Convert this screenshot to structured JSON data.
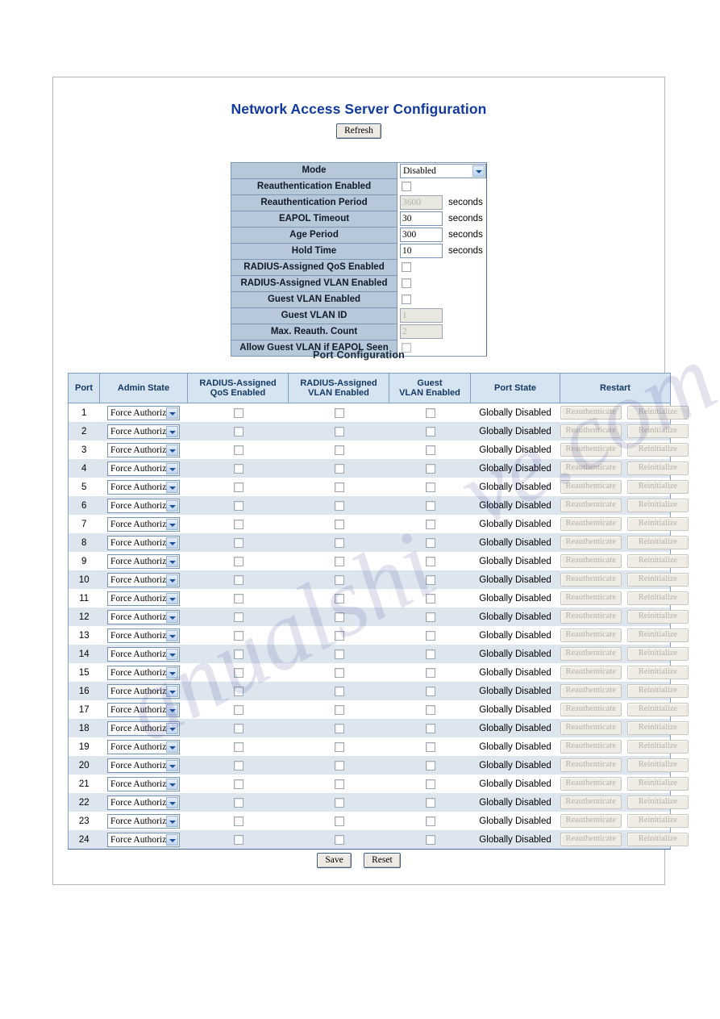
{
  "page": {
    "title": "Network Access Server Configuration",
    "refresh_label": "Refresh",
    "section_heading": "Port Configuration",
    "save_label": "Save",
    "reset_label": "Reset",
    "watermark_1": "ve.com",
    "watermark_2": "anualshi"
  },
  "global_config": {
    "rows": [
      {
        "label": "Mode",
        "control": "select",
        "value": "Disabled",
        "unit": "",
        "disabled": false
      },
      {
        "label": "Reauthentication Enabled",
        "control": "checkbox",
        "value": "",
        "unit": "",
        "disabled": false,
        "checked": false
      },
      {
        "label": "Reauthentication Period",
        "control": "text",
        "value": "3600",
        "unit": "seconds",
        "disabled": true
      },
      {
        "label": "EAPOL Timeout",
        "control": "text",
        "value": "30",
        "unit": "seconds",
        "disabled": false
      },
      {
        "label": "Age Period",
        "control": "text",
        "value": "300",
        "unit": "seconds",
        "disabled": false
      },
      {
        "label": "Hold Time",
        "control": "text",
        "value": "10",
        "unit": "seconds",
        "disabled": false
      },
      {
        "label": "RADIUS-Assigned QoS Enabled",
        "control": "checkbox",
        "value": "",
        "unit": "",
        "disabled": false,
        "checked": false
      },
      {
        "label": "RADIUS-Assigned VLAN Enabled",
        "control": "checkbox",
        "value": "",
        "unit": "",
        "disabled": false,
        "checked": false
      },
      {
        "label": "Guest VLAN Enabled",
        "control": "checkbox",
        "value": "",
        "unit": "",
        "disabled": false,
        "checked": false
      },
      {
        "label": "Guest VLAN ID",
        "control": "text",
        "value": "1",
        "unit": "",
        "disabled": true
      },
      {
        "label": "Max. Reauth. Count",
        "control": "text",
        "value": "2",
        "unit": "",
        "disabled": true
      },
      {
        "label": "Allow Guest VLAN if EAPOL Seen",
        "control": "checkbox",
        "value": "",
        "unit": "",
        "disabled": true,
        "checked": false
      }
    ]
  },
  "port_table": {
    "headers": [
      "Port",
      "Admin State",
      "RADIUS-Assigned\nQoS Enabled",
      "RADIUS-Assigned\nVLAN Enabled",
      "Guest\nVLAN Enabled",
      "Port State",
      "Restart"
    ],
    "restart_buttons": {
      "reauthenticate": "Reauthenticate",
      "reinitialize": "Reinitialize"
    },
    "rows": [
      {
        "port": "1",
        "admin_state": "Force Authorized",
        "radius_qos": false,
        "radius_vlan": false,
        "guest_vlan": false,
        "port_state": "Globally Disabled"
      },
      {
        "port": "2",
        "admin_state": "Force Authorized",
        "radius_qos": false,
        "radius_vlan": false,
        "guest_vlan": false,
        "port_state": "Globally Disabled"
      },
      {
        "port": "3",
        "admin_state": "Force Authorized",
        "radius_qos": false,
        "radius_vlan": false,
        "guest_vlan": false,
        "port_state": "Globally Disabled"
      },
      {
        "port": "4",
        "admin_state": "Force Authorized",
        "radius_qos": false,
        "radius_vlan": false,
        "guest_vlan": false,
        "port_state": "Globally Disabled"
      },
      {
        "port": "5",
        "admin_state": "Force Authorized",
        "radius_qos": false,
        "radius_vlan": false,
        "guest_vlan": false,
        "port_state": "Globally Disabled"
      },
      {
        "port": "6",
        "admin_state": "Force Authorized",
        "radius_qos": false,
        "radius_vlan": false,
        "guest_vlan": false,
        "port_state": "Globally Disabled"
      },
      {
        "port": "7",
        "admin_state": "Force Authorized",
        "radius_qos": false,
        "radius_vlan": false,
        "guest_vlan": false,
        "port_state": "Globally Disabled"
      },
      {
        "port": "8",
        "admin_state": "Force Authorized",
        "radius_qos": false,
        "radius_vlan": false,
        "guest_vlan": false,
        "port_state": "Globally Disabled"
      },
      {
        "port": "9",
        "admin_state": "Force Authorized",
        "radius_qos": false,
        "radius_vlan": false,
        "guest_vlan": false,
        "port_state": "Globally Disabled"
      },
      {
        "port": "10",
        "admin_state": "Force Authorized",
        "radius_qos": false,
        "radius_vlan": false,
        "guest_vlan": false,
        "port_state": "Globally Disabled"
      },
      {
        "port": "11",
        "admin_state": "Force Authorized",
        "radius_qos": false,
        "radius_vlan": false,
        "guest_vlan": false,
        "port_state": "Globally Disabled"
      },
      {
        "port": "12",
        "admin_state": "Force Authorized",
        "radius_qos": false,
        "radius_vlan": false,
        "guest_vlan": false,
        "port_state": "Globally Disabled"
      },
      {
        "port": "13",
        "admin_state": "Force Authorized",
        "radius_qos": false,
        "radius_vlan": false,
        "guest_vlan": false,
        "port_state": "Globally Disabled"
      },
      {
        "port": "14",
        "admin_state": "Force Authorized",
        "radius_qos": false,
        "radius_vlan": false,
        "guest_vlan": false,
        "port_state": "Globally Disabled"
      },
      {
        "port": "15",
        "admin_state": "Force Authorized",
        "radius_qos": false,
        "radius_vlan": false,
        "guest_vlan": false,
        "port_state": "Globally Disabled"
      },
      {
        "port": "16",
        "admin_state": "Force Authorized",
        "radius_qos": false,
        "radius_vlan": false,
        "guest_vlan": false,
        "port_state": "Globally Disabled"
      },
      {
        "port": "17",
        "admin_state": "Force Authorized",
        "radius_qos": false,
        "radius_vlan": false,
        "guest_vlan": false,
        "port_state": "Globally Disabled"
      },
      {
        "port": "18",
        "admin_state": "Force Authorized",
        "radius_qos": false,
        "radius_vlan": false,
        "guest_vlan": false,
        "port_state": "Globally Disabled"
      },
      {
        "port": "19",
        "admin_state": "Force Authorized",
        "radius_qos": false,
        "radius_vlan": false,
        "guest_vlan": false,
        "port_state": "Globally Disabled"
      },
      {
        "port": "20",
        "admin_state": "Force Authorized",
        "radius_qos": false,
        "radius_vlan": false,
        "guest_vlan": false,
        "port_state": "Globally Disabled"
      },
      {
        "port": "21",
        "admin_state": "Force Authorized",
        "radius_qos": false,
        "radius_vlan": false,
        "guest_vlan": false,
        "port_state": "Globally Disabled"
      },
      {
        "port": "22",
        "admin_state": "Force Authorized",
        "radius_qos": false,
        "radius_vlan": false,
        "guest_vlan": false,
        "port_state": "Globally Disabled"
      },
      {
        "port": "23",
        "admin_state": "Force Authorized",
        "radius_qos": false,
        "radius_vlan": false,
        "guest_vlan": false,
        "port_state": "Globally Disabled"
      },
      {
        "port": "24",
        "admin_state": "Force Authorized",
        "radius_qos": false,
        "radius_vlan": false,
        "guest_vlan": false,
        "port_state": "Globally Disabled"
      }
    ]
  },
  "colors": {
    "title_blue": "#1239a0",
    "label_cell": "#b7c8da",
    "header_cell": "#d6e3f1",
    "alt_row": "#dde6ef",
    "border": "#4d6e96"
  }
}
